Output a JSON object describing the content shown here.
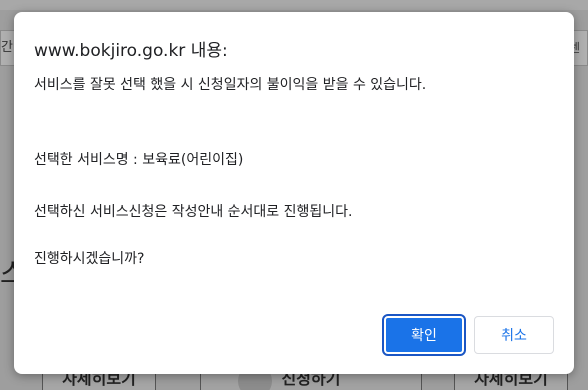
{
  "background": {
    "left_tab_text": "간",
    "right_tab_text": "센터",
    "left_glyph": "스",
    "bottom_buttons": [
      "자세히보기",
      "신청하기",
      "자세히보기"
    ]
  },
  "dialog": {
    "title": "www.bokjiro.go.kr 내용:",
    "lines": [
      "서비스를 잘못 선택 했을 시 신청일자의 불이익을 받을 수 있습니다.",
      "선택한 서비스명 : 보육료(어린이집)",
      "선택하신 서비스신청은 작성안내 순서대로 진행됩니다.",
      "진행하시겠습니까?"
    ],
    "ok_label": "확인",
    "cancel_label": "취소"
  },
  "colors": {
    "primary": "#1a73e8",
    "overlay": "#9e9e9e"
  }
}
